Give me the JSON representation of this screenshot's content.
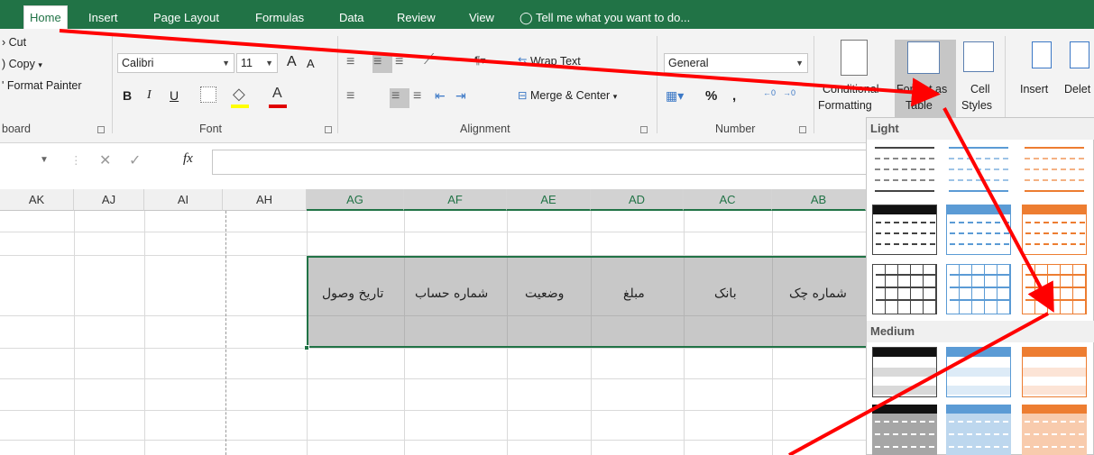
{
  "tabs": [
    {
      "id": "home",
      "label": "Home"
    },
    {
      "id": "insert",
      "label": "Insert"
    },
    {
      "id": "page-layout",
      "label": "Page Layout"
    },
    {
      "id": "formulas",
      "label": "Formulas"
    },
    {
      "id": "data",
      "label": "Data"
    },
    {
      "id": "review",
      "label": "Review"
    },
    {
      "id": "view",
      "label": "View"
    }
  ],
  "tell_me": "Tell me what you want to do...",
  "clipboard": {
    "cut": "Cut",
    "copy": "Copy",
    "painter": "Format Painter",
    "label": "board"
  },
  "font": {
    "name": "Calibri",
    "size": "11",
    "label": "Font",
    "bold": "B",
    "italic": "I",
    "underline": "U",
    "grow": "A",
    "shrink": "A",
    "fontcolor": "A"
  },
  "alignment": {
    "wrap": "Wrap Text",
    "merge": "Merge & Center",
    "label": "Alignment"
  },
  "number": {
    "format": "General",
    "percent": "%",
    "comma": ",",
    "label": "Number"
  },
  "styles": {
    "conditional_line1": "Conditional",
    "conditional_line2": "Formatting",
    "format_line1": "Format as",
    "format_line2": "Table",
    "cell_line1": "Cell",
    "cell_line2": "Styles"
  },
  "cells": {
    "insert": "Insert",
    "delete": "Delet"
  },
  "formula_bar": {
    "fx": "fx"
  },
  "columns": [
    {
      "label": "AK",
      "selected": false
    },
    {
      "label": "AJ",
      "selected": false
    },
    {
      "label": "AI",
      "selected": false
    },
    {
      "label": "AH",
      "selected": false
    },
    {
      "label": "AG",
      "selected": true
    },
    {
      "label": "AF",
      "selected": true
    },
    {
      "label": "AE",
      "selected": true
    },
    {
      "label": "AD",
      "selected": true
    },
    {
      "label": "AC",
      "selected": true
    },
    {
      "label": "AB",
      "selected": true
    }
  ],
  "headers_row": [
    "تاریخ وصول",
    "شماره حساب",
    "وضعیت",
    "مبلغ",
    "بانک",
    "شماره چک"
  ],
  "gallery": {
    "light": "Light",
    "medium": "Medium"
  },
  "colors": {
    "accent": "#217346",
    "blue": "#5b9bd5",
    "orange": "#ed7d31",
    "arrow": "#ff0000"
  }
}
